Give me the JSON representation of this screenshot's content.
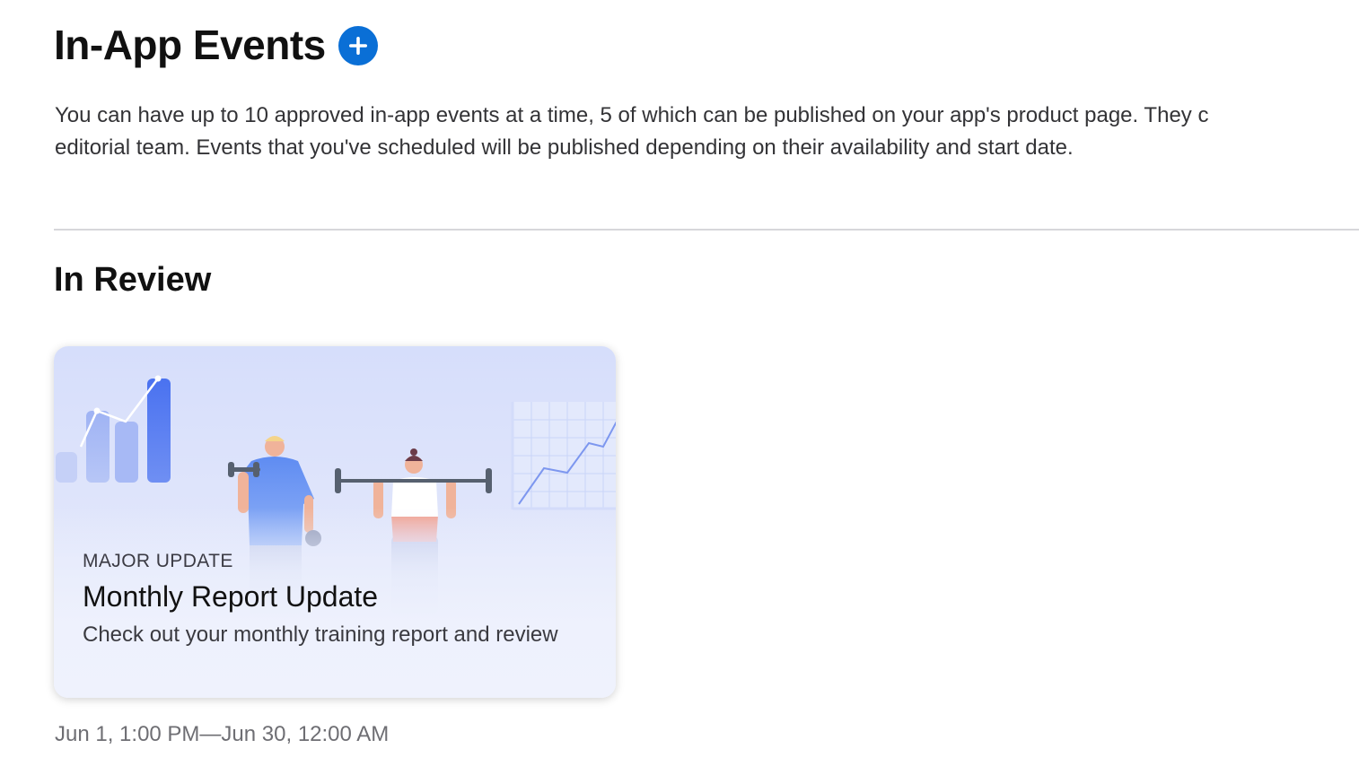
{
  "header": {
    "title": "In-App Events",
    "add_icon": "plus-circle-icon",
    "accent_color": "#0a6fd6"
  },
  "description": {
    "line1": "You can have up to 10 approved in-app events at a time, 5 of which can be published on your app's product page. They c",
    "line2": "editorial team. Events that you've scheduled will be published depending on their availability and start date."
  },
  "sections": [
    {
      "title": "In Review",
      "events": [
        {
          "badge": "MAJOR UPDATE",
          "title": "Monthly Report Update",
          "description": "Check out your monthly training report and review",
          "date_range": "Jun 1, 1:00 PM—Jun 30, 12:00 AM",
          "illustration": "fitness-illustration"
        }
      ]
    }
  ]
}
